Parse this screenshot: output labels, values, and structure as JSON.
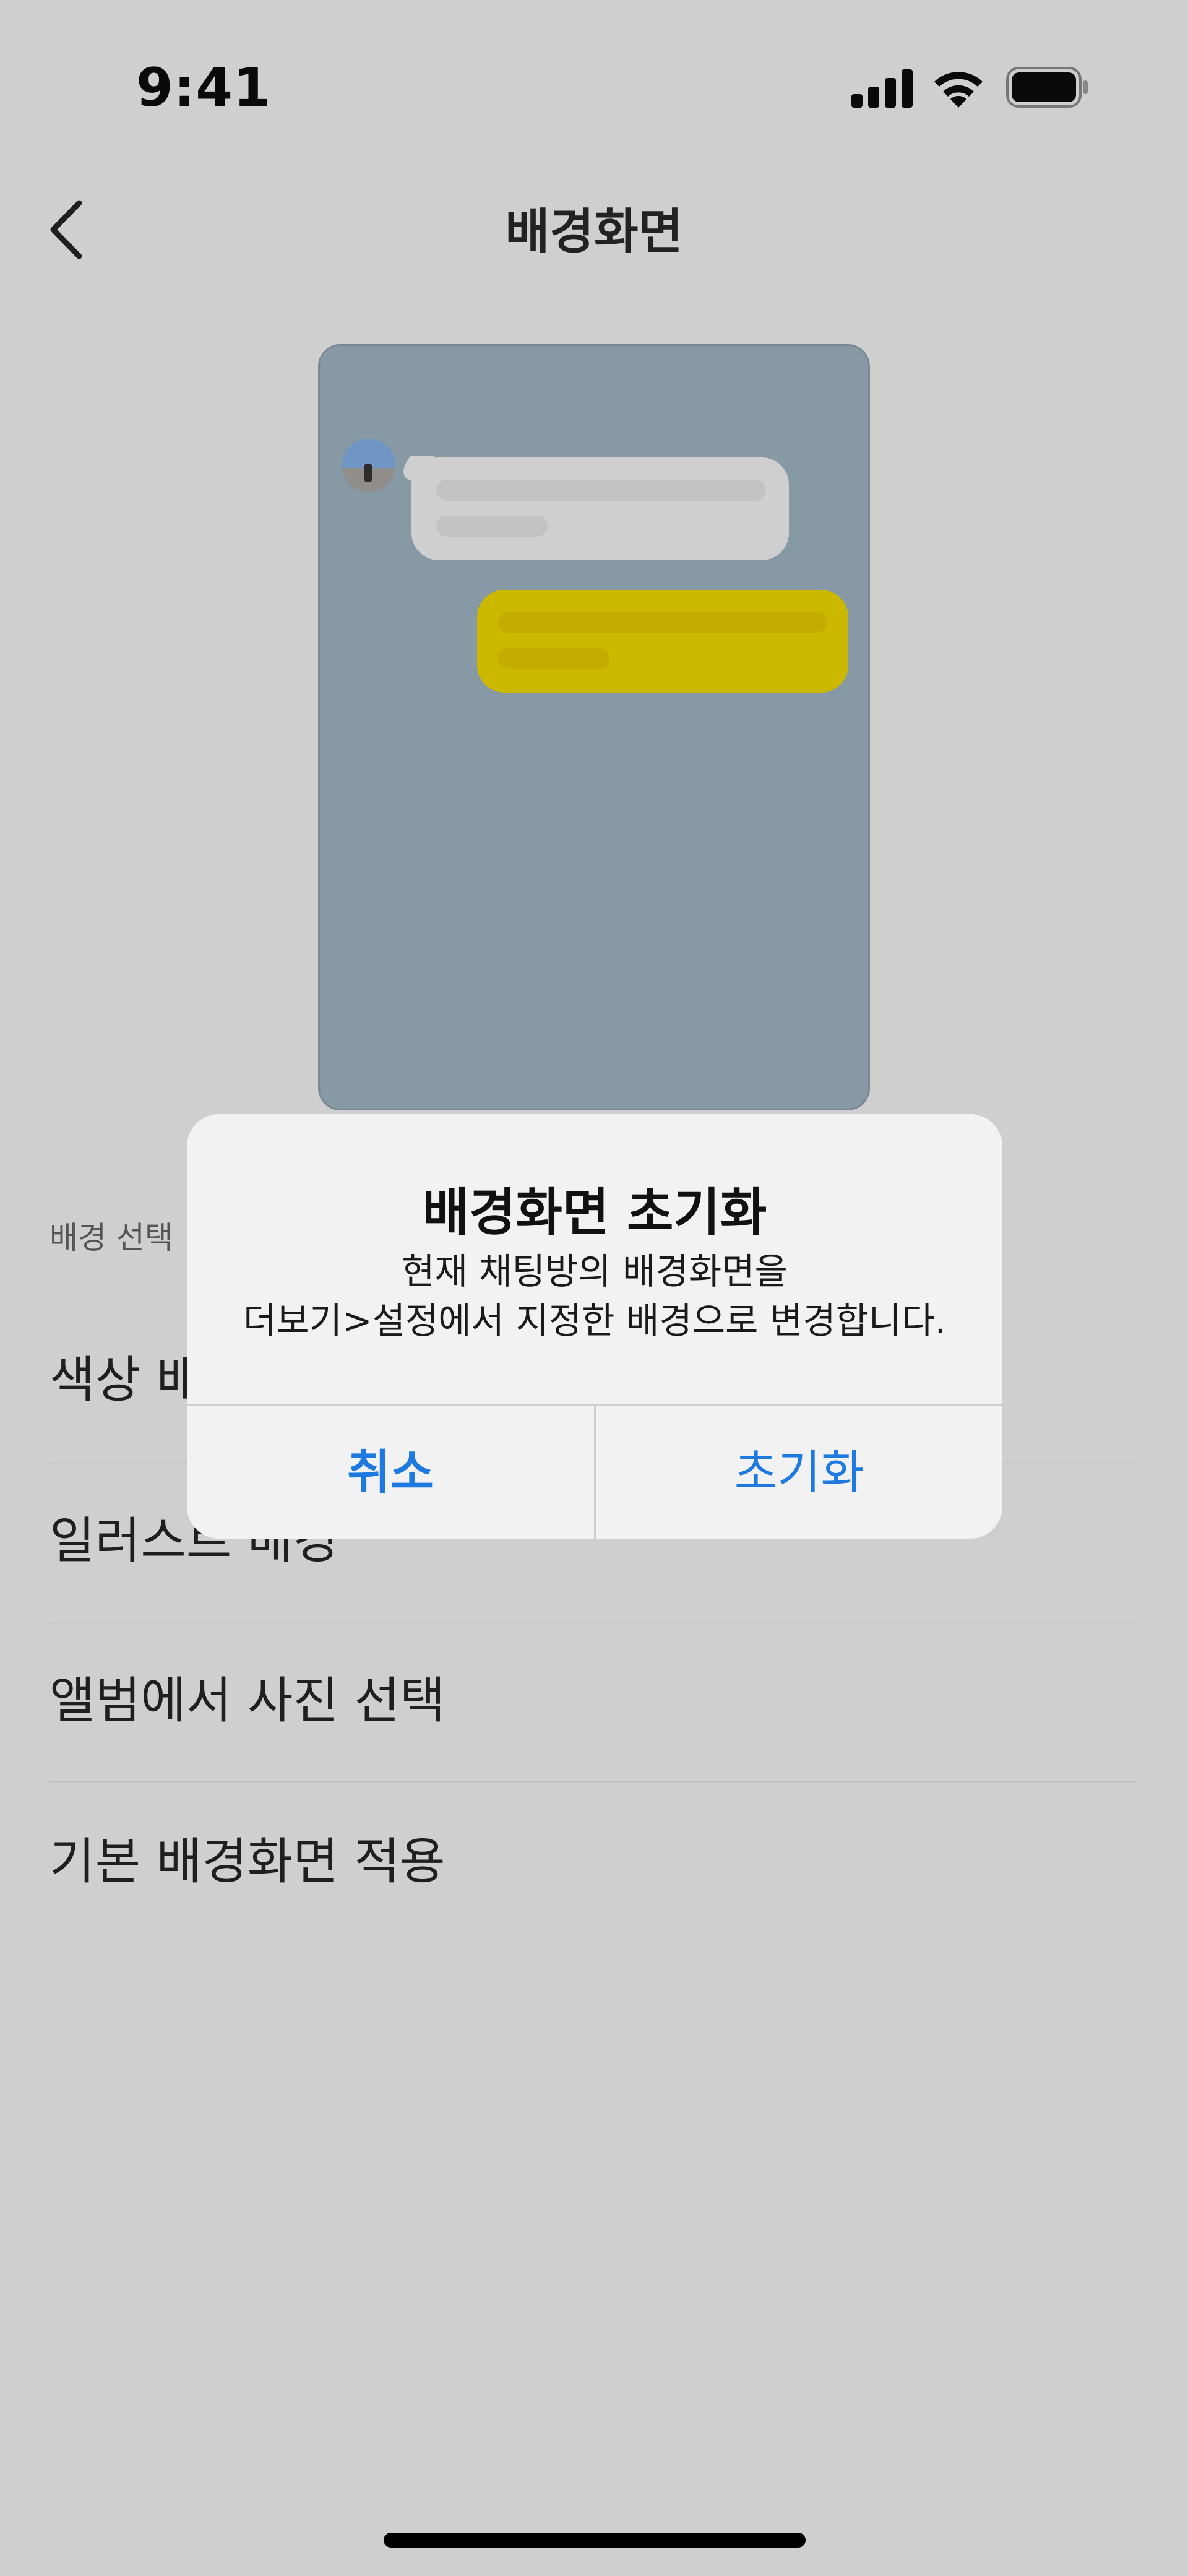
{
  "status_bar": {
    "time": "9:41",
    "icons": [
      "signal-icon",
      "wifi-icon",
      "battery-icon"
    ]
  },
  "header": {
    "title": "배경화면",
    "back_icon": "chevron-left-icon"
  },
  "preview": {
    "background_color": "#8899a6",
    "incoming_bubble_color": "#cfcfcf",
    "outgoing_bubble_color": "#cdb800"
  },
  "settings": {
    "section_label": "배경 선택",
    "items": [
      {
        "label": "색상 배경"
      },
      {
        "label": "일러스트 배경"
      },
      {
        "label": "앨범에서 사진 선택"
      },
      {
        "label": "기본 배경화면 적용"
      }
    ]
  },
  "alert": {
    "title": "배경화면 초기화",
    "message_line1": "현재 채팅방의 배경화면을",
    "message_line2": "더보기>설정에서 지정한 배경으로 변경합니다.",
    "cancel_label": "취소",
    "confirm_label": "초기화",
    "button_color": "#1e7ae0"
  }
}
